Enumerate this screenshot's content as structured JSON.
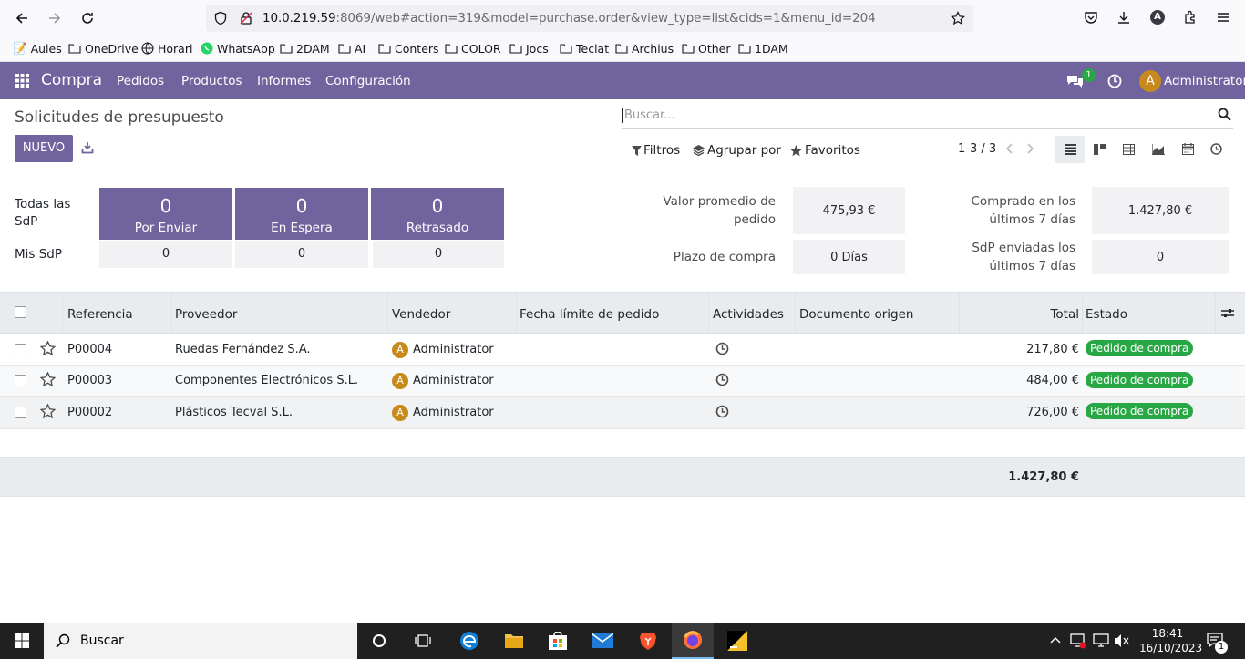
{
  "browser": {
    "url_host": "10.0.219.59",
    "url_rest": ":8069/web#action=319&model=purchase.order&view_type=list&cids=1&menu_id=204",
    "bookmarks": [
      "Aules",
      "OneDrive",
      "Horari",
      "WhatsApp",
      "2DAM",
      "AI",
      "Conters",
      "COLOR",
      "Jocs",
      "Teclat",
      "Archius",
      "Other",
      "1DAM"
    ]
  },
  "navbar": {
    "app_name": "Compra",
    "menu": [
      "Pedidos",
      "Productos",
      "Informes",
      "Configuración"
    ],
    "chat_badge": "1",
    "user_initial": "A",
    "user_name": "Administrator"
  },
  "control_panel": {
    "title": "Solicitudes de presupuesto",
    "new_button": "NUEVO",
    "search_placeholder": "Buscar...",
    "filters": "Filtros",
    "group_by": "Agrupar por",
    "favorites": "Favoritos",
    "pager": "1-3 / 3"
  },
  "dashboard": {
    "all_label": "Todas las SdP",
    "my_label": "Mis SdP",
    "tiles": [
      {
        "value": "0",
        "label": "Por Enviar",
        "mine": "0"
      },
      {
        "value": "0",
        "label": "En Espera",
        "mine": "0"
      },
      {
        "value": "0",
        "label": "Retrasado",
        "mine": "0"
      }
    ],
    "avg_order_label": "Valor promedio de pedido",
    "avg_order_value": "475,93 €",
    "lead_time_label": "Plazo de compra",
    "lead_time_value": "0 Días",
    "purchased_label": "Comprado en los últimos 7 días",
    "purchased_value": "1.427,80 €",
    "sent_label": "SdP enviadas los últimos 7 días",
    "sent_value": "0"
  },
  "table": {
    "columns": [
      "Referencia",
      "Proveedor",
      "Vendedor",
      "Fecha límite de pedido",
      "Actividades",
      "Documento origen",
      "Total",
      "Estado"
    ],
    "rows": [
      {
        "ref": "P00004",
        "vendor": "Ruedas Fernández S.A.",
        "user_initial": "A",
        "user": "Administrator",
        "total": "217,80 €",
        "state": "Pedido de compra"
      },
      {
        "ref": "P00003",
        "vendor": "Componentes Electrónicos S.L.",
        "user_initial": "A",
        "user": "Administrator",
        "total": "484,00 €",
        "state": "Pedido de compra"
      },
      {
        "ref": "P00002",
        "vendor": "Plásticos Tecval S.L.",
        "user_initial": "A",
        "user": "Administrator",
        "total": "726,00 €",
        "state": "Pedido de compra"
      }
    ],
    "grand_total": "1.427,80 €"
  },
  "taskbar": {
    "search_placeholder": "Buscar",
    "time": "18:41",
    "date": "16/10/2023",
    "notification_count": "1"
  },
  "colors": {
    "brand": "#71639e",
    "success": "#28a745",
    "avatar": "#c88a1d"
  }
}
